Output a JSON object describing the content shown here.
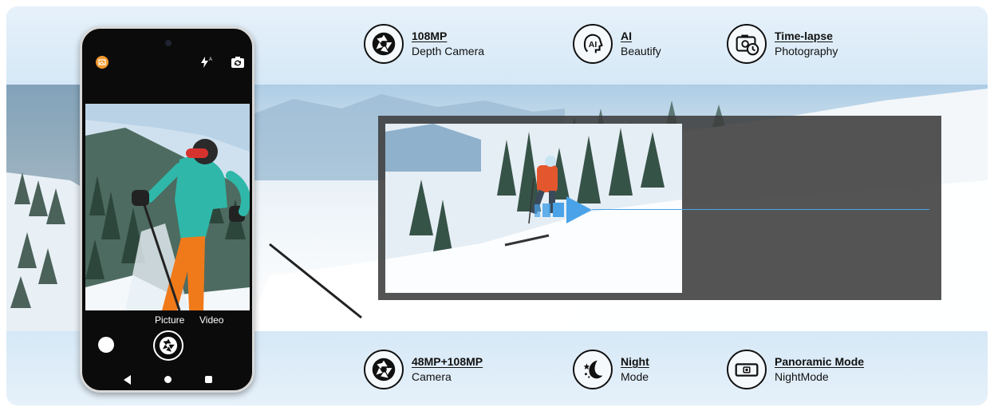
{
  "features_top": [
    {
      "title": "108MP",
      "subtitle": "Depth Camera",
      "icon": "aperture-icon"
    },
    {
      "title": "AI",
      "subtitle": "Beautify",
      "icon": "ai-face-icon"
    },
    {
      "title": "Time-lapse",
      "subtitle": "Photography",
      "icon": "timelapse-camera-icon"
    }
  ],
  "features_bottom": [
    {
      "title": "48MP+108MP",
      "subtitle": "Camera",
      "icon": "aperture-icon"
    },
    {
      "title": "Night",
      "subtitle": "Mode",
      "icon": "moon-stars-icon"
    },
    {
      "title": "Panoramic Mode",
      "subtitle": "NightMode",
      "icon": "panorama-camera-icon"
    }
  ],
  "phone": {
    "modes": [
      "Picture",
      "Video"
    ],
    "icons": [
      "gallery-icon",
      "flash-auto-icon",
      "camera-switch-icon",
      "shutter-aperture-icon"
    ]
  },
  "colors": {
    "band_blue": "#dcebf7",
    "accent_blue": "#4aa3e8",
    "gallery_orange": "#f29a2e"
  }
}
